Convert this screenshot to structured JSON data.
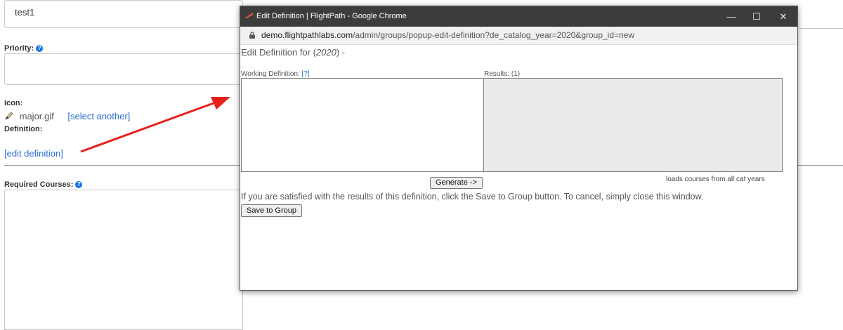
{
  "background": {
    "title_value": "test1",
    "priority_label": "Priority:",
    "icon_label": "Icon:",
    "icon_file": "major.gif",
    "select_another_link": "[select another]",
    "definition_label": "Definition:",
    "edit_definition_link": "[edit definition]",
    "required_courses_label": "Required Courses:",
    "help_glyph": "?"
  },
  "popup": {
    "window_title": "Edit Definition | FlightPath - Google Chrome",
    "url_host": "demo.flightpathlabs.com",
    "url_path": "/admin/groups/popup-edit-definition?de_catalog_year=2020&group_id=new",
    "heading_prefix": "Edit Definition for (",
    "heading_year": "2020",
    "heading_suffix": ") -",
    "working_definition_label": "Working Definition:",
    "working_definition_help": "[?]",
    "results_label": "Results: (1)",
    "generate_button": "Generate ->",
    "note": "loads courses from all cat years",
    "instructions": "If you are satisfied with the results of this definition, click the Save to Group button. To cancel, simply close this window.",
    "save_button": "Save to Group",
    "window_controls": {
      "minimize": "—",
      "maximize": "☐",
      "close": "✕"
    }
  },
  "colors": {
    "titlebar": "#3c3c3c",
    "link": "#2b6fcf",
    "arrow": "#e8201c",
    "help_icon": "#1a73e8",
    "results_bg": "#ebebeb"
  },
  "icons": [
    "help-icon",
    "pencil-icon",
    "lock-icon",
    "flightpath-app-icon",
    "minimize-icon",
    "maximize-icon",
    "close-icon"
  ]
}
